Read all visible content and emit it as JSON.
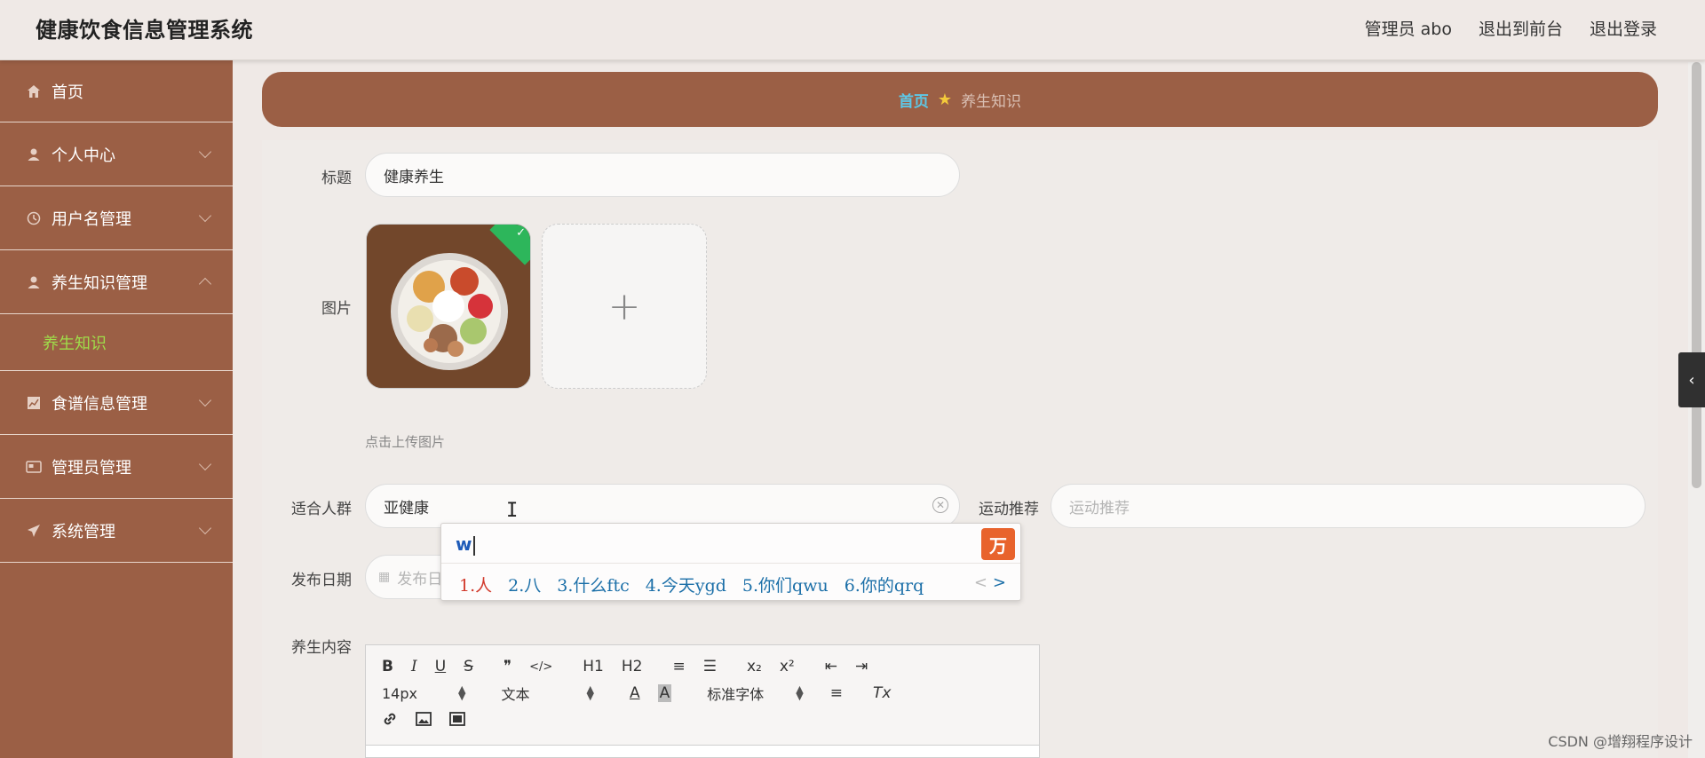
{
  "header": {
    "app_title": "健康饮食信息管理系统",
    "admin_label": "管理员 abo",
    "exit_front": "退出到前台",
    "logout": "退出登录"
  },
  "sidebar": {
    "items": [
      {
        "label": "首页",
        "icon": "home-icon",
        "expandable": false
      },
      {
        "label": "个人中心",
        "icon": "user-icon",
        "expandable": true
      },
      {
        "label": "用户名管理",
        "icon": "clock-icon",
        "expandable": true
      },
      {
        "label": "养生知识管理",
        "icon": "user-icon",
        "expandable": true,
        "expanded": true,
        "children": [
          "养生知识"
        ]
      },
      {
        "label": "食谱信息管理",
        "icon": "chart-icon",
        "expandable": true
      },
      {
        "label": "管理员管理",
        "icon": "card-icon",
        "expandable": true
      },
      {
        "label": "系统管理",
        "icon": "send-icon",
        "expandable": true
      }
    ]
  },
  "breadcrumb": {
    "home": "首页",
    "current": "养生知识"
  },
  "form": {
    "title_label": "标题",
    "title_value": "健康养生",
    "image_label": "图片",
    "upload_plus": "+",
    "upload_hint": "点击上传图片",
    "crowd_label": "适合人群",
    "crowd_value": "亚健康",
    "sport_label": "运动推荐",
    "sport_placeholder": "运动推荐",
    "date_label": "发布日期",
    "date_placeholder": "发布日",
    "content_label": "养生内容"
  },
  "ime": {
    "input": "w",
    "candidates": [
      "1.人",
      "2.八",
      "3.什么ftc",
      "4.今天ygd",
      "5.你们qwu",
      "6.你的qrq"
    ],
    "prev": "<",
    "next": ">"
  },
  "editor": {
    "row1": [
      "B",
      "I",
      "U",
      "S",
      "❞",
      "</>",
      "H1",
      "H2",
      "≡",
      "☰",
      "x₂",
      "x²",
      "⇤",
      "⇥"
    ],
    "font_size": "14px",
    "text_style": "文本",
    "font_family": "标准字体",
    "clear_format": "Tx"
  },
  "watermark": "CSDN @增翔程序设计"
}
